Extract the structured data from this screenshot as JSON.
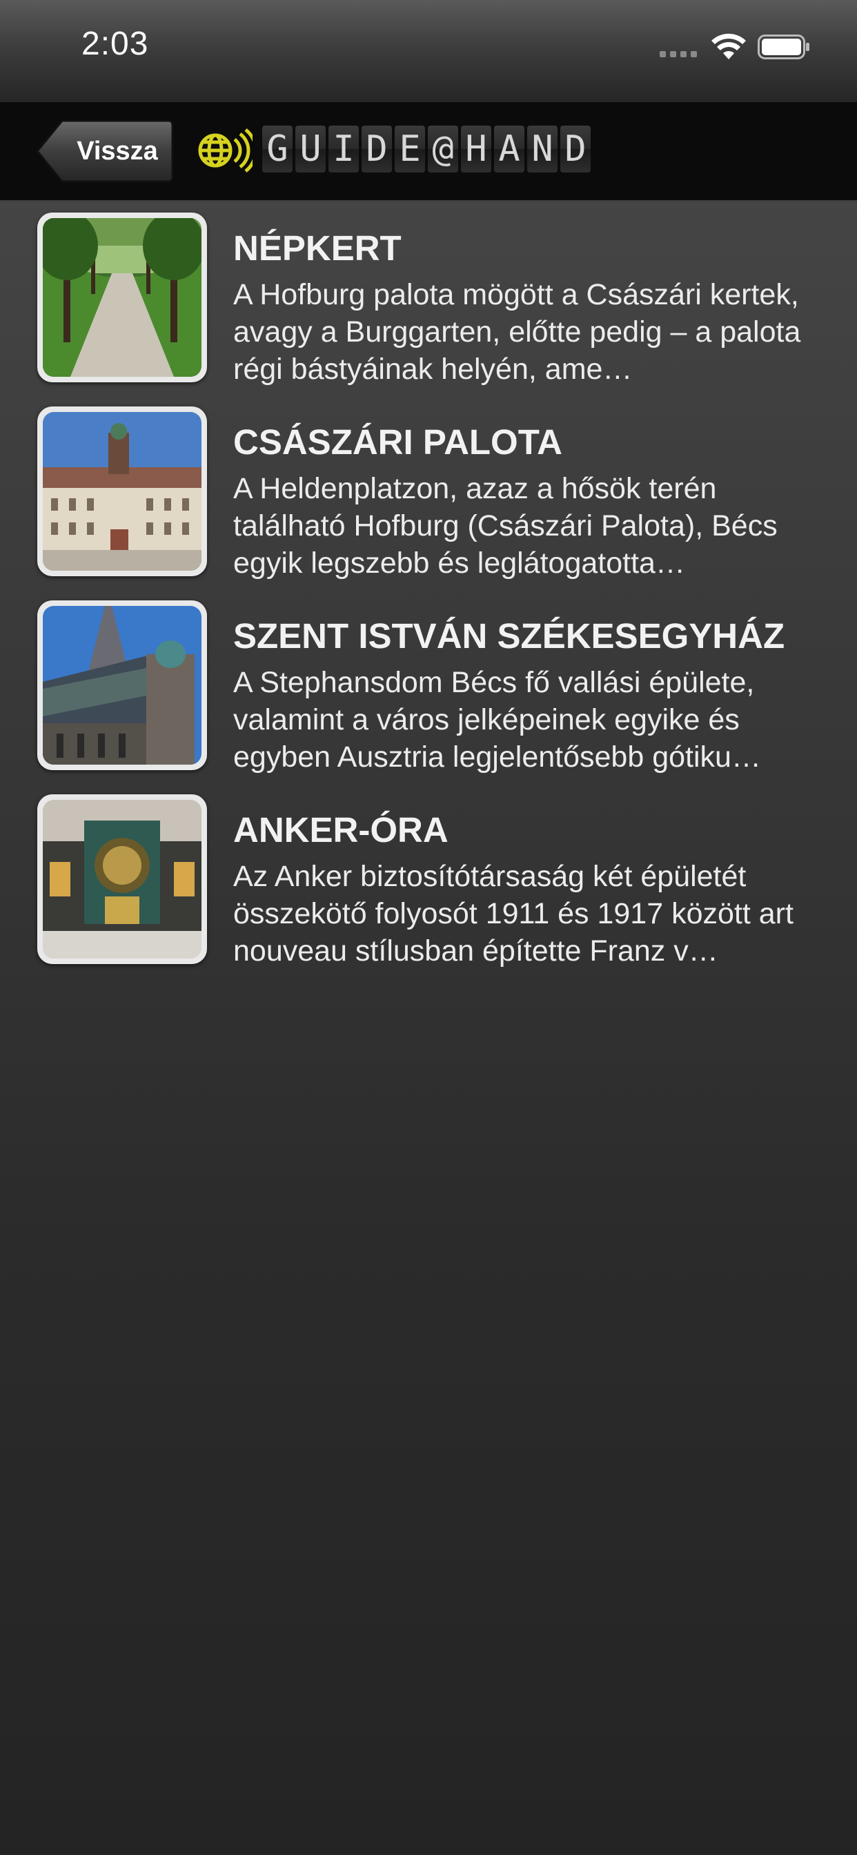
{
  "status_bar": {
    "time": "2:03"
  },
  "nav": {
    "back_label": "Vissza",
    "logo_text": [
      "G",
      "U",
      "I",
      "D",
      "E",
      "@",
      "H",
      "A",
      "N",
      "D"
    ],
    "logo_color": "#d6d21f"
  },
  "items": [
    {
      "title": "NÉPKERT",
      "description": "A Hofburg palota mögött a Császári kertek, avagy a Burggarten, előtte pedig – a palota régi bástyáinak helyén, ame…",
      "image_icon": "park-avenue-thumbnail"
    },
    {
      "title": "CSÁSZÁRI PALOTA",
      "description": "A Heldenplatzon, azaz a hősök terén található Hofburg (Császári Palota), Bécs egyik legszebb és leglátogatotta…",
      "image_icon": "palace-thumbnail"
    },
    {
      "title": "SZENT ISTVÁN SZÉKESEGYHÁZ",
      "description": "A Stephansdom Bécs fő vallási épülete, valamint a város jelképeinek egyike és egyben Ausztria legjelentősebb gótiku…",
      "image_icon": "cathedral-thumbnail"
    },
    {
      "title": "ANKER-ÓRA",
      "description": "Az Anker biztosítótársaság két épületét összekötő folyosót 1911 és 1917 között art nouveau stílusban építette Franz v…",
      "image_icon": "clock-thumbnail"
    }
  ]
}
